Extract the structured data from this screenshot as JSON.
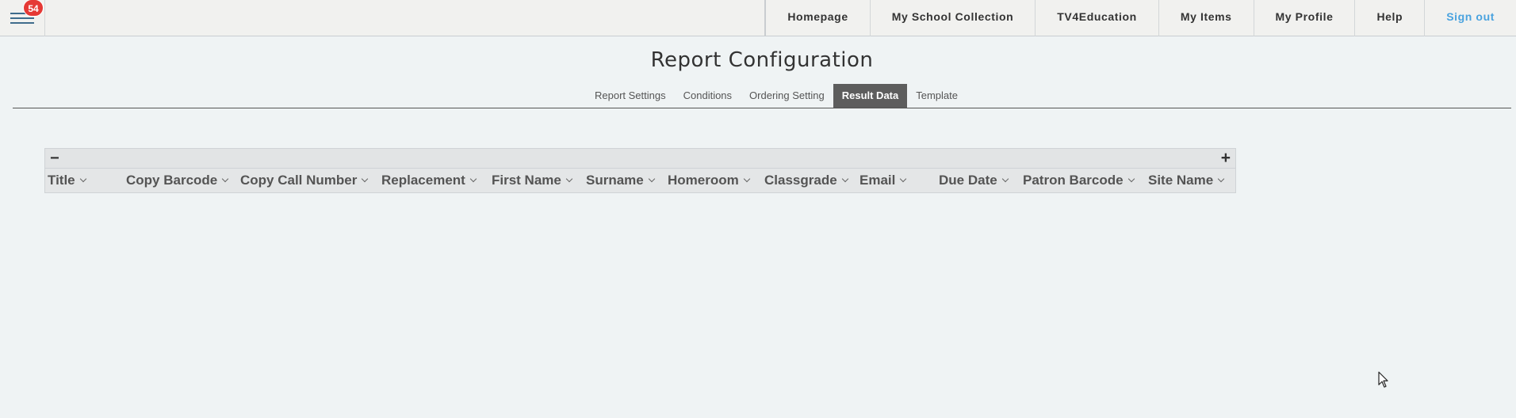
{
  "topbar": {
    "notification_count": "54",
    "nav": [
      {
        "label": "Homepage",
        "name": "nav-homepage"
      },
      {
        "label": "My School Collection",
        "name": "nav-my-school-collection"
      },
      {
        "label": "TV4Education",
        "name": "nav-tv4education"
      },
      {
        "label": "My Items",
        "name": "nav-my-items"
      },
      {
        "label": "My Profile",
        "name": "nav-my-profile"
      },
      {
        "label": "Help",
        "name": "nav-help"
      },
      {
        "label": "Sign out",
        "name": "nav-sign-out"
      }
    ]
  },
  "page": {
    "title": "Report Configuration",
    "tabs": [
      {
        "label": "Report Settings",
        "active": false
      },
      {
        "label": "Conditions",
        "active": false
      },
      {
        "label": "Ordering Setting",
        "active": false
      },
      {
        "label": "Result Data",
        "active": true
      },
      {
        "label": "Template",
        "active": false
      }
    ]
  },
  "grid": {
    "collapse_symbol": "−",
    "expand_symbol": "+",
    "columns": [
      "Title",
      "Copy Barcode",
      "Copy Call Number",
      "Replacement",
      "First Name",
      "Surname",
      "Homeroom",
      "Classgrade",
      "Email",
      "Due Date",
      "Patron Barcode",
      "Site Name"
    ]
  },
  "colors": {
    "accent": "#4aa3df",
    "badge": "#e53935",
    "active_tab": "#5d5d5d",
    "background": "#eff3f4"
  }
}
